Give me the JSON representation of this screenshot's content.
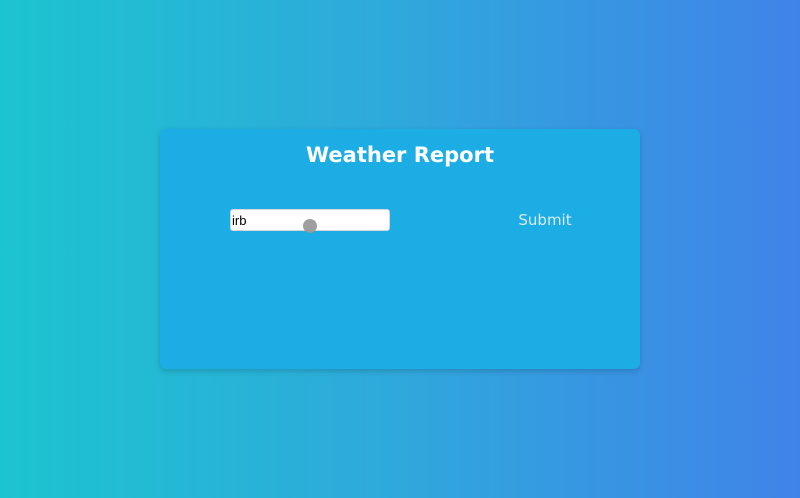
{
  "header": {
    "title": "Weather Report"
  },
  "search": {
    "value": "irb",
    "placeholder": ""
  },
  "actions": {
    "submit_label": "Submit"
  },
  "colors": {
    "background_start": "#1cc4cf",
    "background_end": "#4083e8",
    "card": "#1bade3",
    "title_text": "#ffffff",
    "submit_text": "#d9ecf6"
  }
}
